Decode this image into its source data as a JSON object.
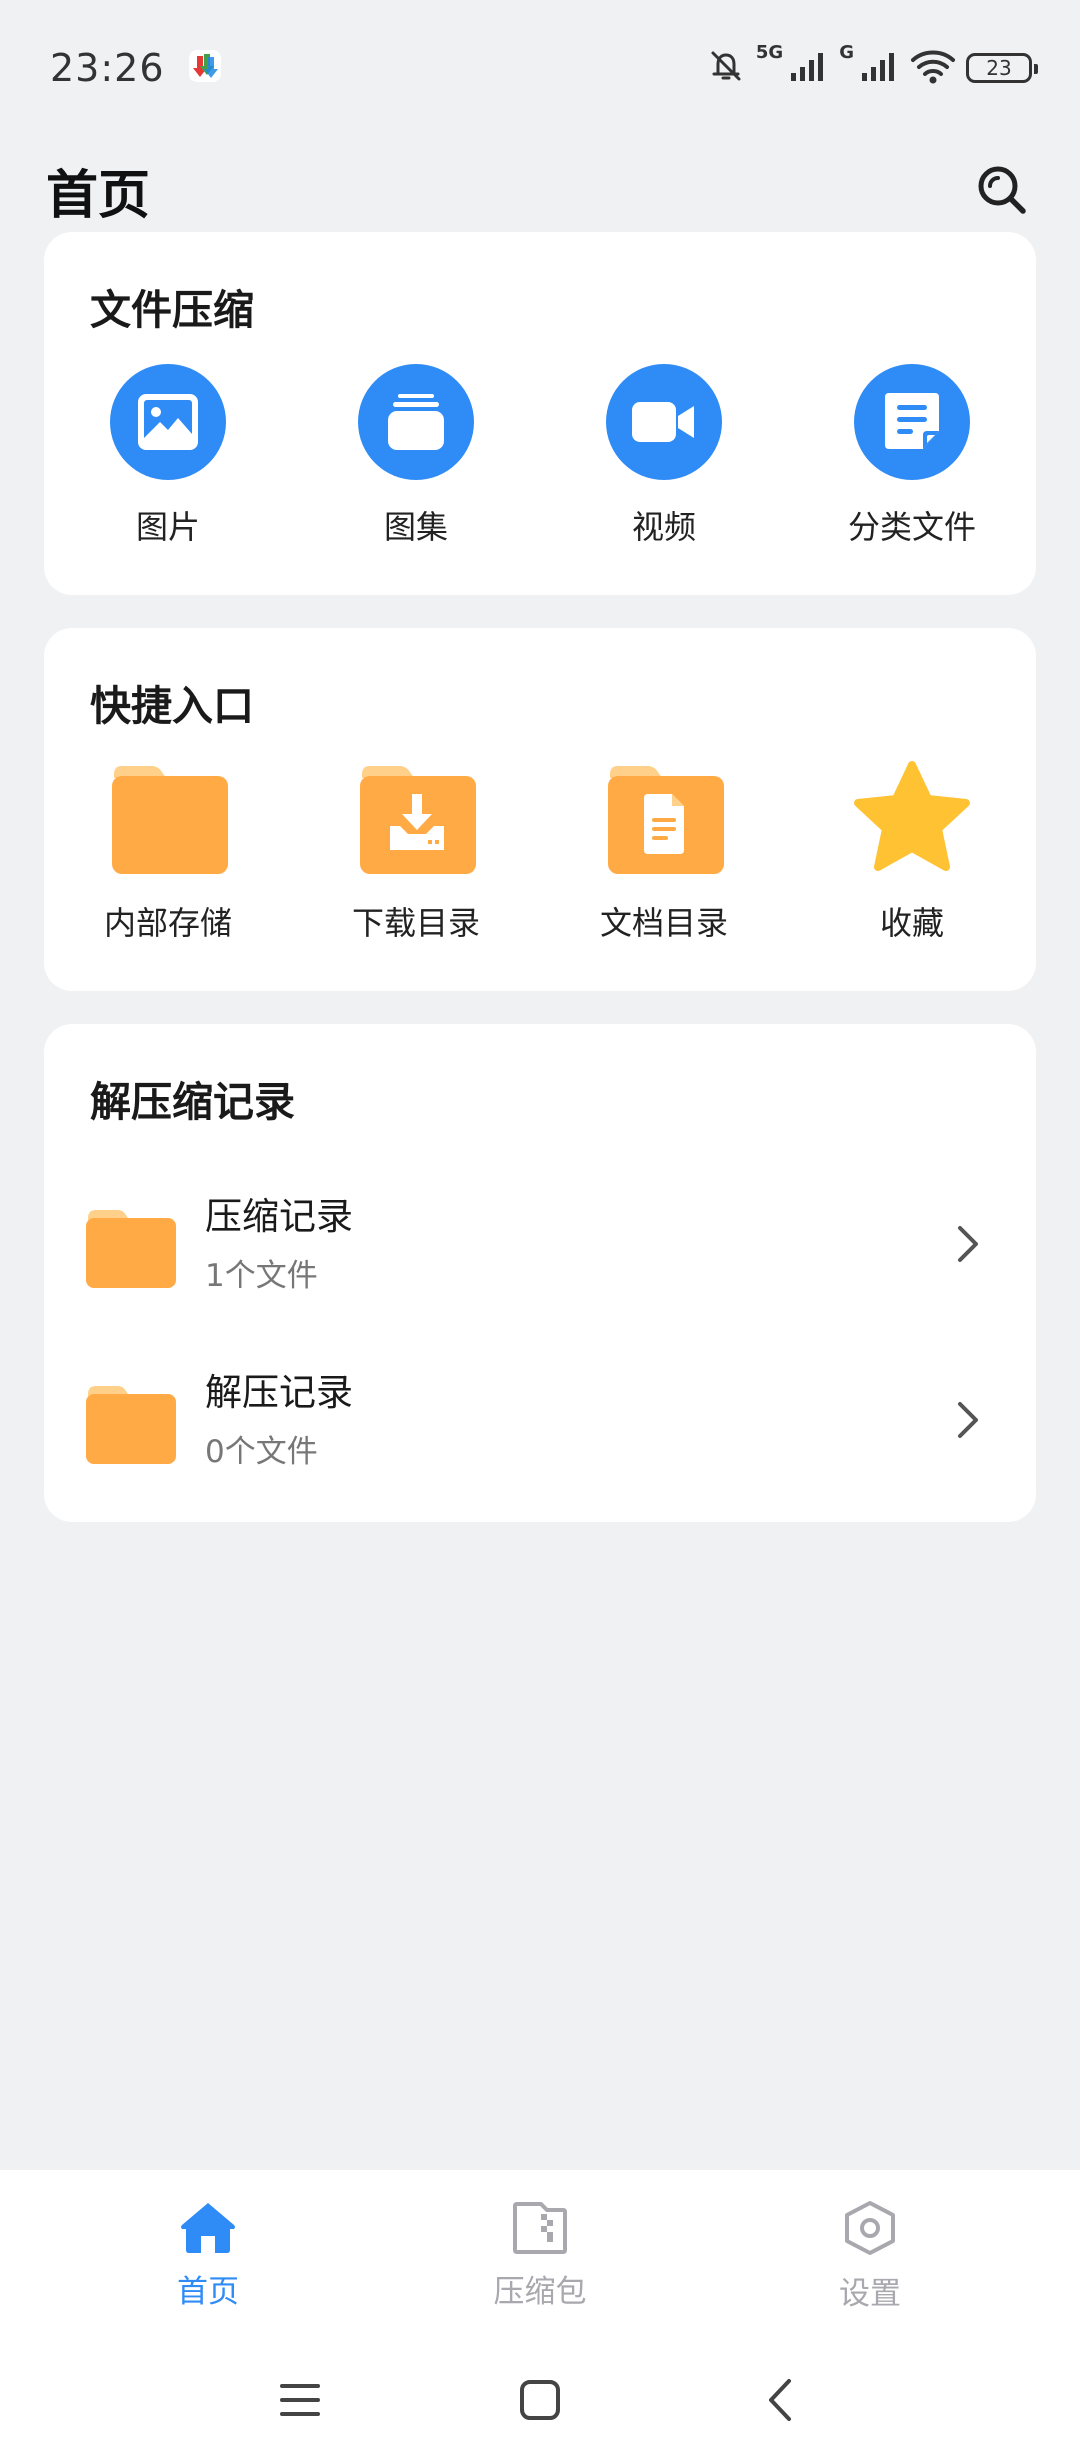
{
  "status_bar": {
    "time": "23:26",
    "network_5g": "5G",
    "network_g": "G",
    "battery": "23"
  },
  "header": {
    "title": "首页"
  },
  "compress_card": {
    "title": "文件压缩",
    "items": [
      {
        "label": "图片",
        "icon": "image-icon"
      },
      {
        "label": "图集",
        "icon": "album-icon"
      },
      {
        "label": "视频",
        "icon": "video-icon"
      },
      {
        "label": "分类文件",
        "icon": "document-icon"
      }
    ]
  },
  "shortcut_card": {
    "title": "快捷入口",
    "items": [
      {
        "label": "内部存储",
        "icon": "folder-icon"
      },
      {
        "label": "下载目录",
        "icon": "download-folder-icon"
      },
      {
        "label": "文档目录",
        "icon": "document-folder-icon"
      },
      {
        "label": "收藏",
        "icon": "star-icon"
      }
    ]
  },
  "records_card": {
    "title": "解压缩记录",
    "items": [
      {
        "title": "压缩记录",
        "subtitle": "1个文件"
      },
      {
        "title": "解压记录",
        "subtitle": "0个文件"
      }
    ]
  },
  "bottom_nav": {
    "items": [
      {
        "label": "首页",
        "active": true
      },
      {
        "label": "压缩包",
        "active": false
      },
      {
        "label": "设置",
        "active": false
      }
    ]
  },
  "colors": {
    "accent": "#2F8CF6",
    "folder": "#FFAA44",
    "star": "#FFC233",
    "inactive": "#A8A8AE",
    "background": "#F0F1F3"
  }
}
